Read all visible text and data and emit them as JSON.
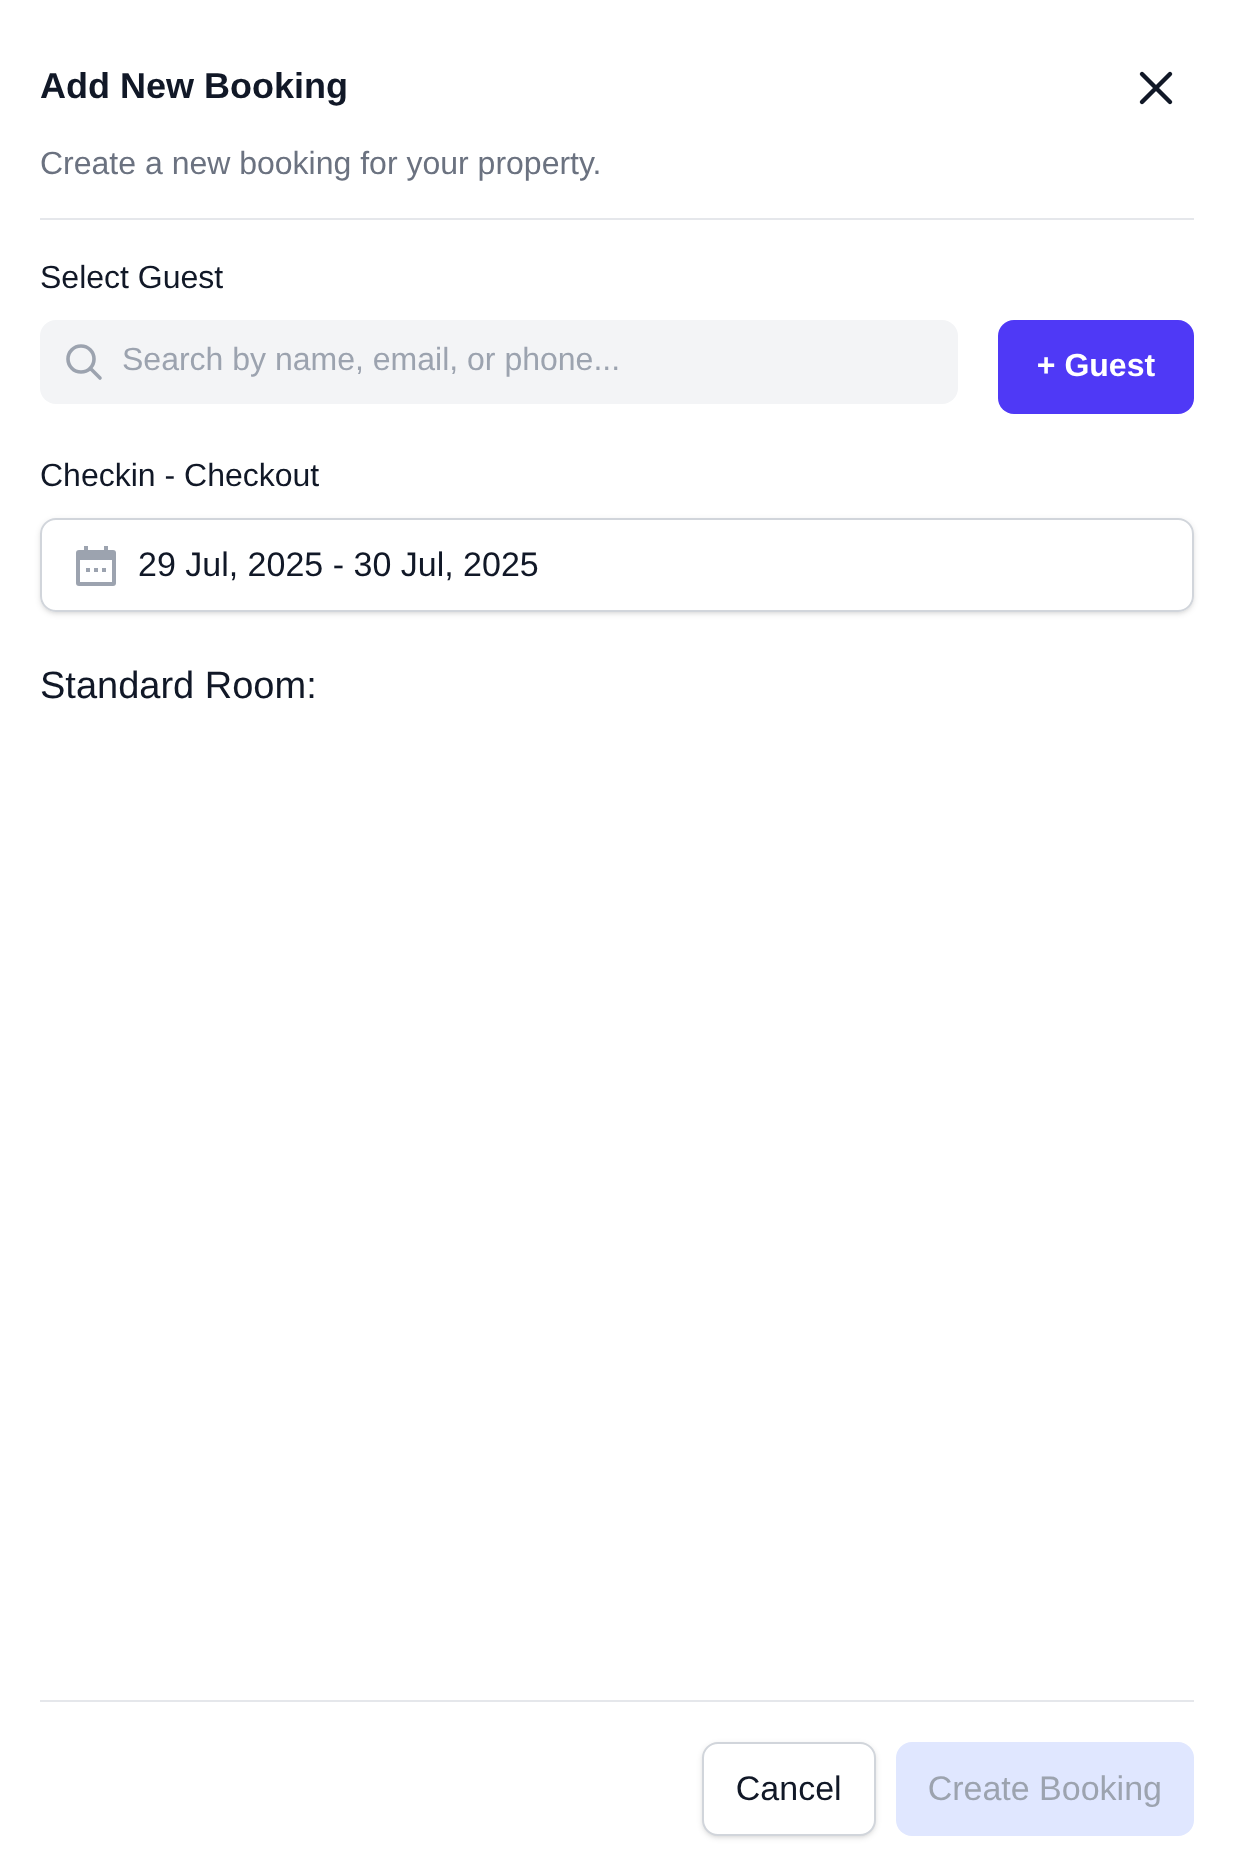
{
  "dialog": {
    "title": "Add New Booking",
    "subtitle": "Create a new booking for your property."
  },
  "guest": {
    "label": "Select Guest",
    "placeholder": "Search by name, email, or phone...",
    "add_button": "+ Guest"
  },
  "dates": {
    "label": "Checkin - Checkout",
    "value": "29 Jul, 2025 - 30 Jul, 2025"
  },
  "room_heading": "Standard Room:",
  "buttons": [
    {
      "label": "Cancel",
      "kind": "secondary",
      "disabled": false
    },
    {
      "label": "Create Booking",
      "kind": "primary",
      "disabled": true
    }
  ]
}
